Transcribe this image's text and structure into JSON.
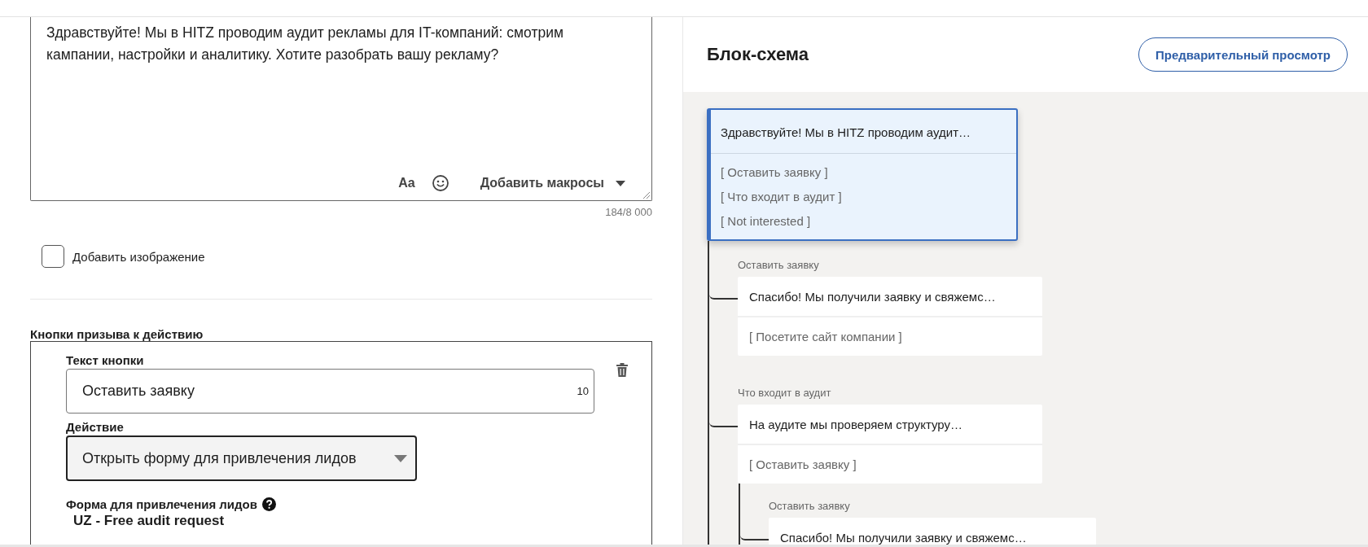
{
  "message_editor": {
    "text": "Здравствуйте! Мы в HITZ проводим аудит рекламы для IT-компаний: смотрим кампании, настройки и аналитику. Хотите разобрать вашу рекламу?",
    "format_button": "Aa",
    "macro_button": "Добавить макросы",
    "counter": "184/8 000"
  },
  "add_image": {
    "label": "Добавить изображение",
    "checked": false
  },
  "cta_section": {
    "title": "Кнопки призыва к действию",
    "buttons": [
      {
        "text_label": "Текст кнопки",
        "text_value": "Оставить заявку",
        "char_count": "10",
        "action_label": "Действие",
        "action_value": "Открыть форму для привлечения лидов",
        "form_label": "Форма для привлечения лидов",
        "form_value": "UZ - Free audit request"
      }
    ]
  },
  "flowchart": {
    "title": "Блок-схема",
    "preview_button": "Предварительный просмотр",
    "root": {
      "selected": true,
      "message": "Здравствуйте! Мы в HITZ проводим аудит…",
      "options": [
        "[ Оставить заявку ]",
        "[ Что входит в аудит ]",
        "[ Not interested ]"
      ],
      "children": [
        {
          "label": "Оставить заявку",
          "selected": false,
          "message": "Спасибо! Мы получили заявку и свяжемс…",
          "options": [
            "[ Посетите сайт компании ]"
          ]
        },
        {
          "label": "Что входит в аудит",
          "selected": false,
          "message": "На аудите мы проверяем структуру…",
          "options": [
            "[ Оставить заявку ]"
          ],
          "children": [
            {
              "label": "Оставить заявку",
              "selected": false,
              "message": "Спасибо! Мы получили заявку и свяжемс…"
            }
          ]
        }
      ]
    }
  }
}
